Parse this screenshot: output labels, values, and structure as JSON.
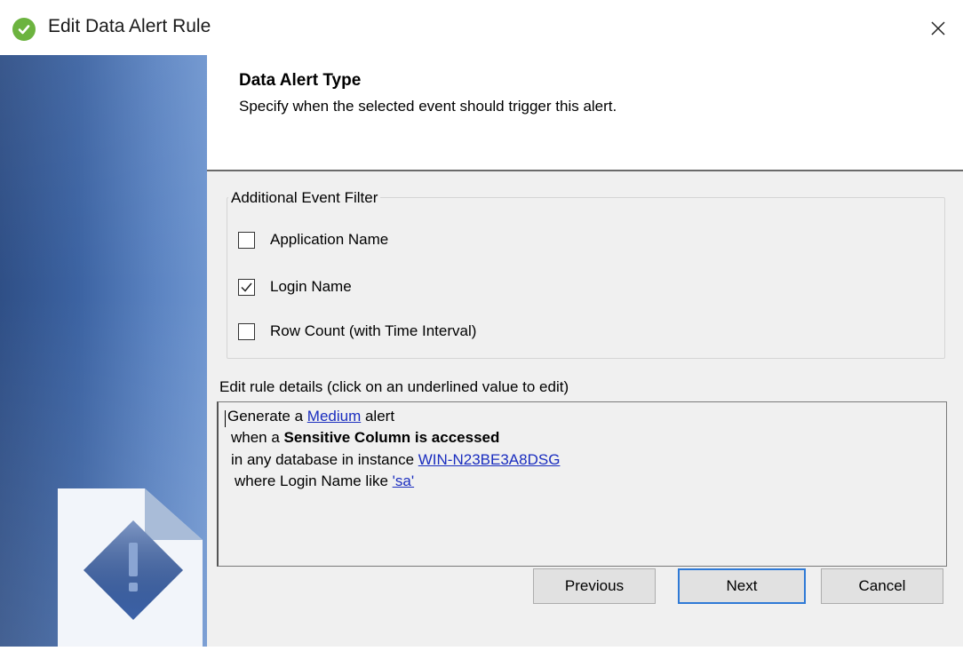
{
  "window": {
    "title": "Edit Data Alert Rule",
    "close_glyph": "×",
    "title_icon": "check-circle-icon",
    "accent_color": "#6cb33f"
  },
  "header": {
    "title": "Data Alert Type",
    "subtitle": "Specify when the selected event should trigger this alert."
  },
  "filter_group": {
    "legend": "Additional Event Filter",
    "items": [
      {
        "label": "Application Name",
        "checked": false
      },
      {
        "label": "Login Name",
        "checked": true
      },
      {
        "label": "Row Count (with Time Interval)",
        "checked": false
      }
    ]
  },
  "rule_details": {
    "label": "Edit rule details (click on an underlined value to edit)",
    "line1": {
      "prefix": "Generate a ",
      "link": "Medium",
      "suffix": " alert"
    },
    "line2": {
      "prefix": "when a ",
      "bold": "Sensitive Column is accessed"
    },
    "line3": {
      "prefix": "in any database in instance ",
      "link": "WIN-N23BE3A8DSG"
    },
    "line4": {
      "prefix": "where Login Name like ",
      "link": "'sa'"
    },
    "link_color": "#1a2dbf"
  },
  "buttons": {
    "previous": "Previous",
    "next": "Next",
    "cancel": "Cancel"
  },
  "sidebar": {
    "icon": "document-warning-icon"
  }
}
